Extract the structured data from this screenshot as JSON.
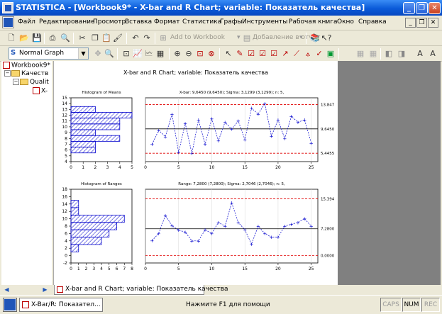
{
  "window": {
    "title": "STATISTICA - [Workbook9* - X-bar and R Chart; variable:  Показатель качества]",
    "colors": {
      "titlebar": "#0a5ad8",
      "graph_bg": "#808080",
      "series": "#0000cc",
      "control_limit": "#e00000"
    }
  },
  "menu": [
    "Файл",
    "Редактирование",
    "Просмотр",
    "Вставка",
    "Формат",
    "Статистика",
    "Графы",
    "Инструменты",
    "Рабочая книга",
    "Окно",
    "Справка"
  ],
  "toolbar": {
    "add_workbook": "Add to Workbook",
    "add_report": "Добавление в отчет",
    "graph_type": "Normal Graph"
  },
  "tree": {
    "root": "Workbook9*",
    "folder1": "Качеств",
    "folder2": "Qualit",
    "item": "X-"
  },
  "chart_data": [
    {
      "type": "bar",
      "orientation": "horizontal",
      "title": "Histogram of Means",
      "categories": [
        6,
        7,
        8,
        9,
        10,
        11,
        12,
        13
      ],
      "values": [
        2,
        2,
        4,
        2,
        4,
        4,
        5,
        2
      ],
      "xlim": [
        0,
        5
      ],
      "ylim": [
        4,
        15
      ],
      "xticks": [
        0,
        1,
        2,
        3,
        4,
        5
      ],
      "yticks": [
        4,
        5,
        6,
        7,
        8,
        9,
        10,
        11,
        12,
        13,
        14,
        15
      ]
    },
    {
      "type": "line",
      "title": "X-bar: 9,6450 (9,6450); Sigma: 3,1299 (3,1299); n: 5,",
      "x": [
        1,
        2,
        3,
        4,
        5,
        6,
        7,
        8,
        9,
        10,
        11,
        12,
        13,
        14,
        15,
        16,
        17,
        18,
        19,
        20,
        21,
        22,
        23,
        24,
        25
      ],
      "y": [
        7.0,
        9.4,
        8.3,
        12.2,
        5.6,
        10.6,
        5.4,
        11.2,
        7.0,
        11.4,
        7.6,
        10.8,
        9.6,
        11.0,
        7.8,
        13.2,
        12.2,
        14.0,
        8.4,
        11.2,
        8.0,
        11.8,
        10.8,
        11.2,
        7.2
      ],
      "center": 9.645,
      "ucl": 13.847,
      "lcl": 5.4455,
      "limit_labels": [
        "13,847",
        "9,6450",
        "5,4455"
      ],
      "xlim": [
        0,
        26
      ],
      "ylim": [
        4,
        15
      ],
      "xticks": [
        0,
        5,
        10,
        15,
        20,
        25
      ],
      "grid": true
    },
    {
      "type": "bar",
      "orientation": "horizontal",
      "title": "Histogram of Ranges",
      "categories": [
        2,
        4,
        6,
        8,
        10,
        12,
        14
      ],
      "values": [
        1,
        4,
        5,
        6,
        7,
        1,
        1
      ],
      "xlim": [
        0,
        8
      ],
      "ylim": [
        -2,
        18
      ],
      "xticks": [
        0,
        1,
        2,
        3,
        4,
        5,
        6,
        7,
        8
      ],
      "yticks": [
        -2,
        0,
        2,
        4,
        6,
        8,
        10,
        12,
        14,
        16,
        18
      ]
    },
    {
      "type": "line",
      "title": "Range: 7,2800 (7,2800); Sigma: 2,7046 (2,7046); n: 5,",
      "x": [
        1,
        2,
        3,
        4,
        5,
        6,
        7,
        8,
        9,
        10,
        11,
        12,
        13,
        14,
        15,
        16,
        17,
        18,
        19,
        20,
        21,
        22,
        23,
        24,
        25
      ],
      "y": [
        4.1,
        6.0,
        10.9,
        8.1,
        6.9,
        6.4,
        4.0,
        4.0,
        7.0,
        6.0,
        9.0,
        8.0,
        14.3,
        9.0,
        7.0,
        3.1,
        8.0,
        6.0,
        5.0,
        5.0,
        8.0,
        8.5,
        9.0,
        10.0,
        8.0
      ],
      "center": 7.28,
      "ucl": 15.394,
      "lcl": 0,
      "limit_labels": [
        "15,394",
        "7,2800",
        "0,0000"
      ],
      "xlim": [
        0,
        26
      ],
      "ylim": [
        -2,
        18
      ],
      "xticks": [
        0,
        5,
        10,
        15,
        20,
        25
      ],
      "grid": true
    }
  ],
  "chart_title": "X-bar and R Chart; variable:  Показатель качества",
  "tab": {
    "label": "X-bar and R Chart; variable:  Показатель качества"
  },
  "status": {
    "task": "X-Bar/R: Показател...",
    "message": "Нажмите F1 для помощи",
    "caps": "CAPS",
    "num": "NUM",
    "rec": "REC"
  }
}
